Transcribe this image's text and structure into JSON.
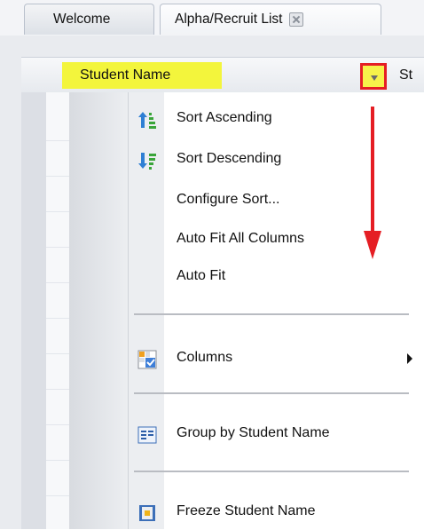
{
  "tabs": [
    {
      "label": "Welcome"
    },
    {
      "label": "Alpha/Recruit List"
    }
  ],
  "grid": {
    "column_label": "Student Name",
    "next_column_label": "St"
  },
  "context_menu": {
    "items": [
      {
        "label": "Sort Ascending",
        "icon": "sort-ascending-icon"
      },
      {
        "label": "Sort Descending",
        "icon": "sort-descending-icon"
      },
      {
        "label": "Configure Sort..."
      },
      {
        "label": "Auto Fit All Columns"
      },
      {
        "label": "Auto Fit"
      },
      {
        "label": "Columns",
        "icon": "columns-icon"
      },
      {
        "label": "Group by Student Name",
        "icon": "group-by-icon"
      },
      {
        "label": "Freeze Student Name",
        "icon": "freeze-icon"
      }
    ]
  },
  "colors": {
    "header_highlight": "#f3f53c",
    "annotation_red": "#e51e24"
  }
}
